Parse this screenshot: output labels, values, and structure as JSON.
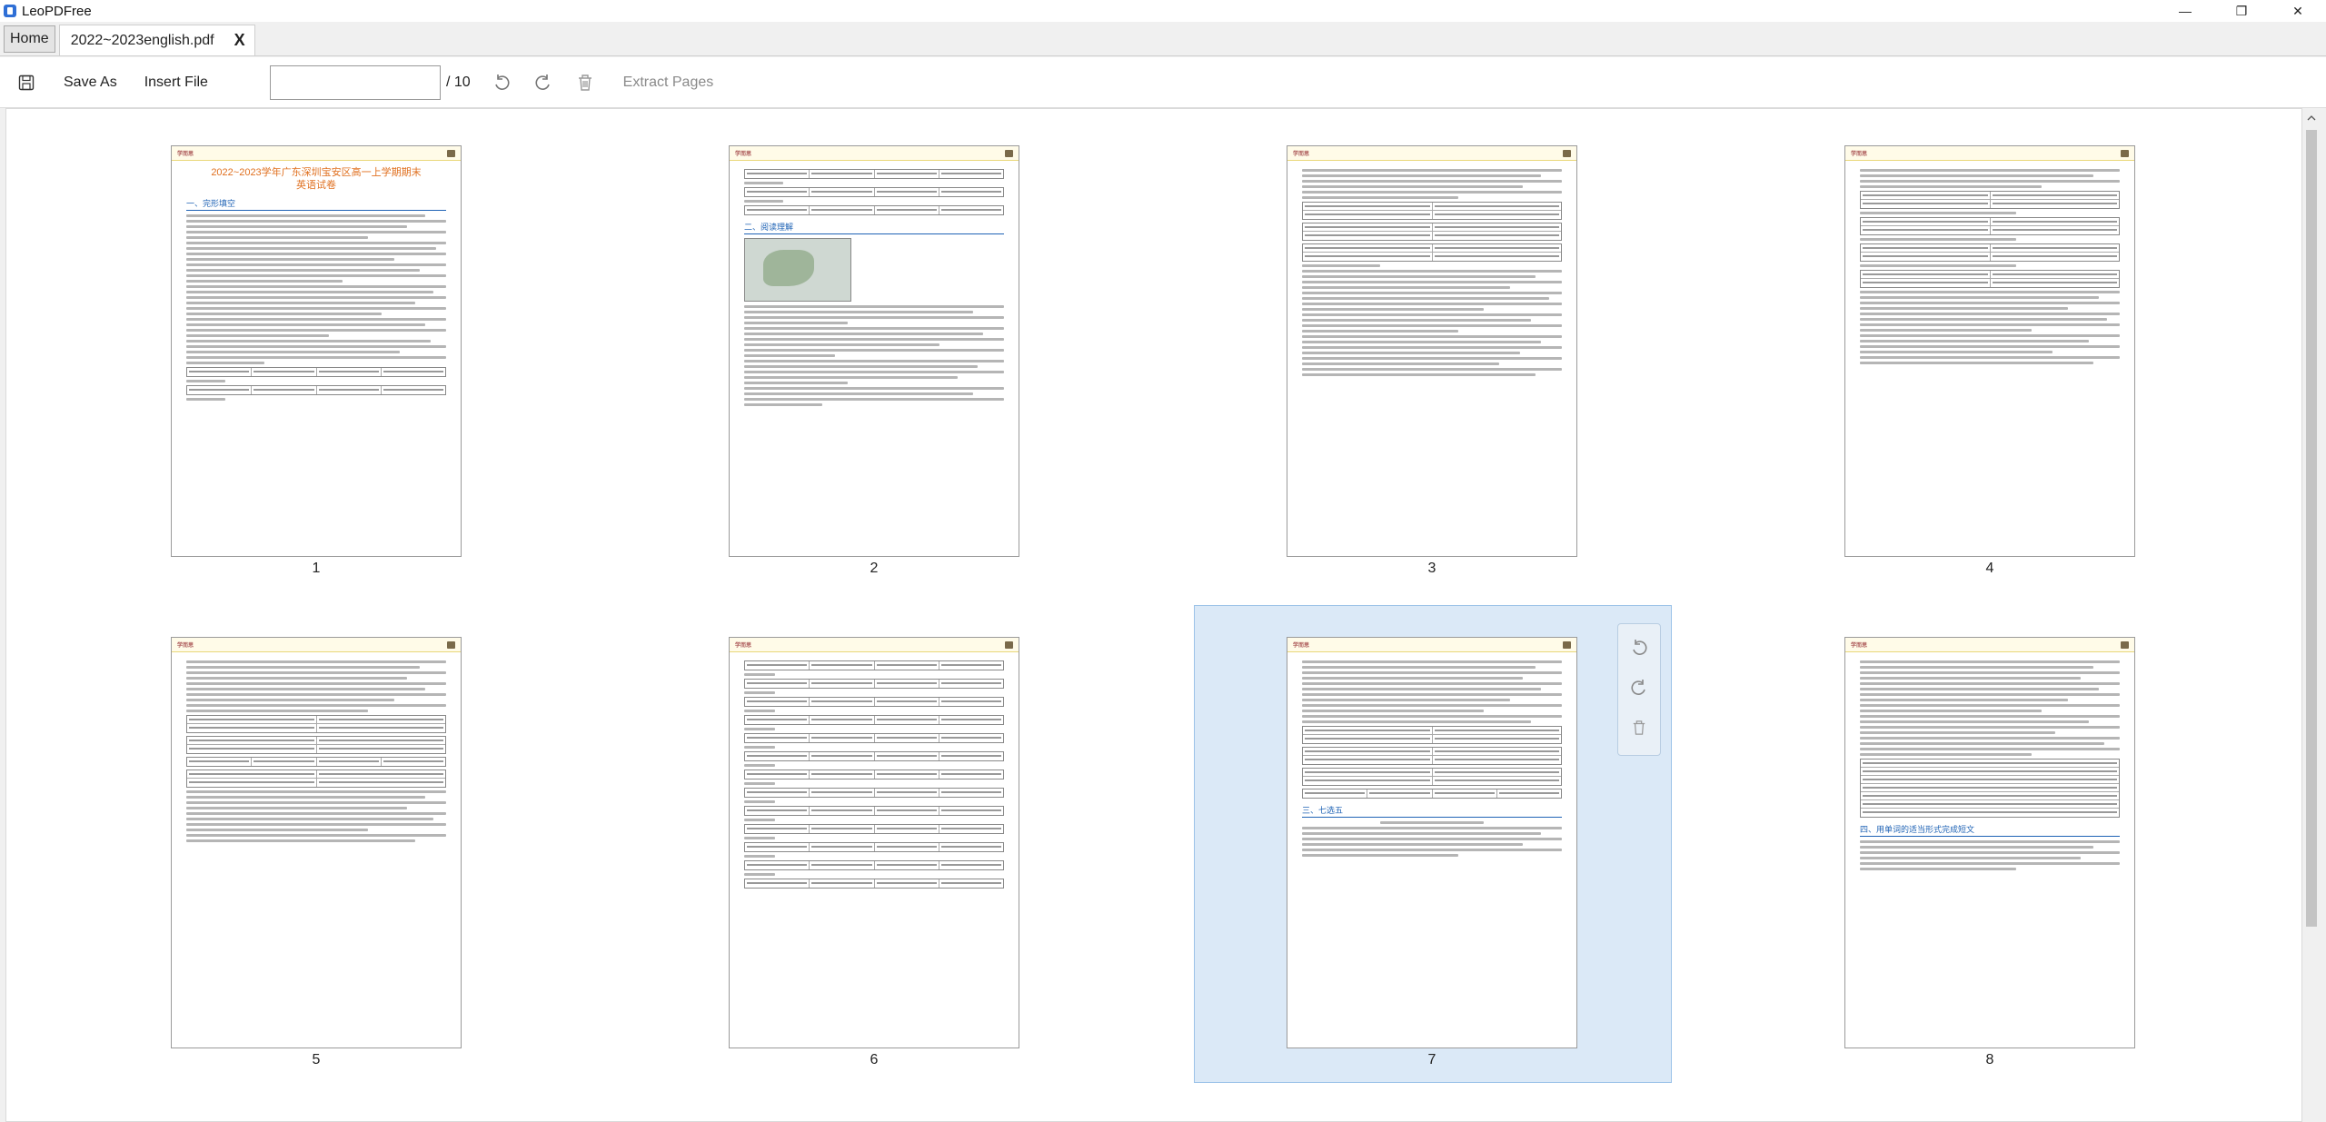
{
  "app": {
    "title": "LeoPDFree"
  },
  "window_controls": {
    "minimize": "—",
    "maximize": "❐",
    "close": "✕"
  },
  "tabs": {
    "home": "Home",
    "file": "2022~2023english.pdf",
    "close": "X"
  },
  "toolbar": {
    "save_as": "Save As",
    "insert_file": "Insert File",
    "page_input_value": "",
    "page_total": "/ 10",
    "extract_pages": "Extract Pages"
  },
  "pages": [
    {
      "label": "1"
    },
    {
      "label": "2"
    },
    {
      "label": "3"
    },
    {
      "label": "4"
    },
    {
      "label": "5"
    },
    {
      "label": "6"
    },
    {
      "label": "7"
    },
    {
      "label": "8"
    }
  ],
  "selected_page": "7",
  "page1": {
    "title_line1": "2022~2023学年广东深圳宝安区高一上学期期末",
    "title_line2": "英语试卷",
    "section1": "一、完形填空"
  },
  "page2": {
    "section2": "二、阅读理解"
  },
  "page7": {
    "section3": "三、七选五"
  },
  "page8": {
    "section4": "四、用单词的适当形式完成短文"
  }
}
